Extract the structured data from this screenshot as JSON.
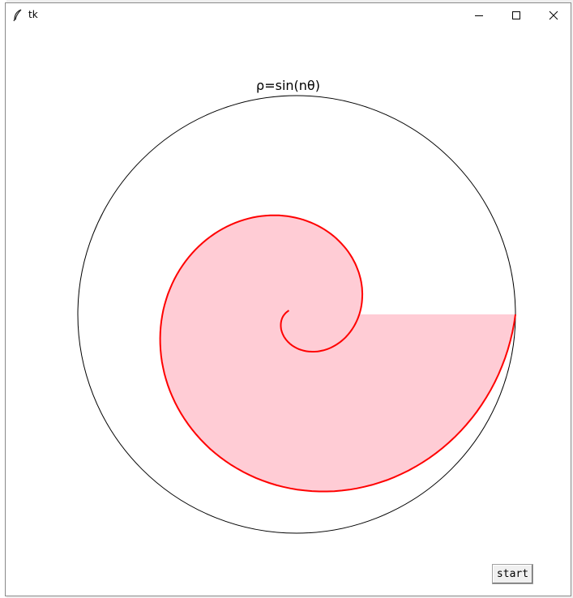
{
  "window": {
    "title": "tk",
    "controls": {
      "minimize": "minimize-icon",
      "maximize": "maximize-icon",
      "close": "close-icon"
    }
  },
  "plot": {
    "title": "ρ=sin(nθ)",
    "curve_color": "#ff0000",
    "fill_color": "#ffccd5",
    "circle_color": "#000000"
  },
  "button": {
    "start_label": "start"
  },
  "colors": {
    "window_bg": "#ffffff",
    "desktop_bg": "#f0f0f0"
  }
}
